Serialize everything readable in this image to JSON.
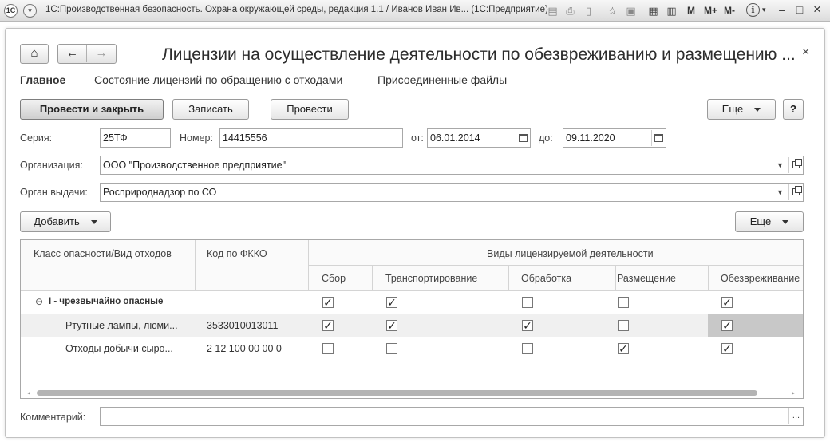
{
  "titlebar": {
    "logo": "1С",
    "title": "1С:Производственная безопасность. Охрана окружающей среды, редакция 1.1 / Иванов Иван Ив...  (1С:Предприятие)",
    "m": "M",
    "m_plus": "M+",
    "m_minus": "M-",
    "info": "i",
    "minimize": "–",
    "maximize": "□",
    "close": "×"
  },
  "nav": {
    "home": "⌂",
    "back": "←",
    "forward": "→"
  },
  "form": {
    "title": "Лицензии на осуществление деятельности по обезвреживанию и размещению ...",
    "close": "×"
  },
  "tabs": [
    {
      "label": "Главное"
    },
    {
      "label": "Состояние лицензий по обращению с отходами"
    },
    {
      "label": "Присоединенные файлы"
    }
  ],
  "toolbar": {
    "post_close": "Провести и закрыть",
    "save": "Записать",
    "post": "Провести",
    "more": "Еще",
    "help": "?"
  },
  "fields": {
    "series_label": "Серия:",
    "series_value": "25ТФ",
    "number_label": "Номер:",
    "number_value": "14415556",
    "from_label": "от:",
    "from_value": "06.01.2014",
    "to_label": "до:",
    "to_value": "09.11.2020",
    "org_label": "Организация:",
    "org_value": "ООО \"Производственное предприятие\"",
    "issuer_label": "Орган выдачи:",
    "issuer_value": "Росприроднадзор по СО",
    "comment_label": "Комментарий:",
    "comment_value": ""
  },
  "table_toolbar": {
    "add": "Добавить",
    "more": "Еще"
  },
  "table": {
    "columns": {
      "class": "Класс опасности/Вид отходов",
      "code": "Код по ФККО",
      "group": "Виды лицензируемой деятельности",
      "collect": "Сбор",
      "transport": "Транспортирование",
      "process": "Обработка",
      "place": "Размещение",
      "neutralize": "Обезвреживание"
    },
    "rows": [
      {
        "name": "I - чрезвычайно опасные",
        "code": "",
        "group": true,
        "checks": [
          "✓",
          "✓",
          "",
          "",
          "✓"
        ]
      },
      {
        "name": "Ртутные лампы, люми...",
        "code": "3533010013011",
        "group": false,
        "checks": [
          "✓",
          "✓",
          "✓",
          "",
          "✓"
        ]
      },
      {
        "name": "Отходы добычи сыро...",
        "code": "2 12 100 00 00 0",
        "group": false,
        "checks": [
          "",
          "",
          "",
          "✓",
          "✓"
        ]
      }
    ],
    "collapse_icon": "⊖"
  }
}
